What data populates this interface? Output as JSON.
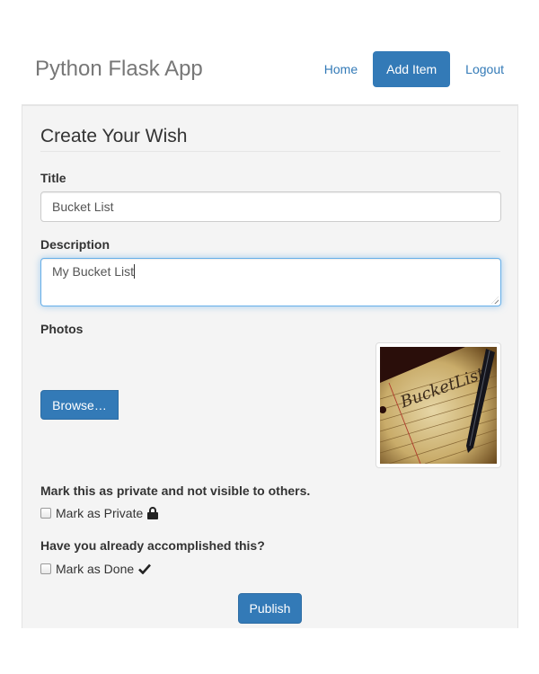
{
  "header": {
    "brand": "Python Flask App",
    "nav": [
      {
        "label": "Home",
        "active": false
      },
      {
        "label": "Add Item",
        "active": true
      },
      {
        "label": "Logout",
        "active": false
      }
    ]
  },
  "form": {
    "legend": "Create Your Wish",
    "title": {
      "label": "Title",
      "value": "Bucket List"
    },
    "description": {
      "label": "Description",
      "value": "My Bucket List"
    },
    "photos": {
      "label": "Photos",
      "browse_label": "Browse…",
      "preview_alt": "Bucket List handwritten on lined paper with a pen"
    },
    "private": {
      "question": "Mark this as private and not visible to others.",
      "checkbox_label": "Mark as Private",
      "checked": false,
      "icon": "lock-icon"
    },
    "done": {
      "question": "Have you already accomplished this?",
      "checkbox_label": "Mark as Done",
      "checked": false,
      "icon": "check-icon"
    },
    "submit_label": "Publish"
  },
  "colors": {
    "primary": "#337ab7",
    "panel_bg": "#f4f4f4",
    "brand_text": "#777777"
  }
}
